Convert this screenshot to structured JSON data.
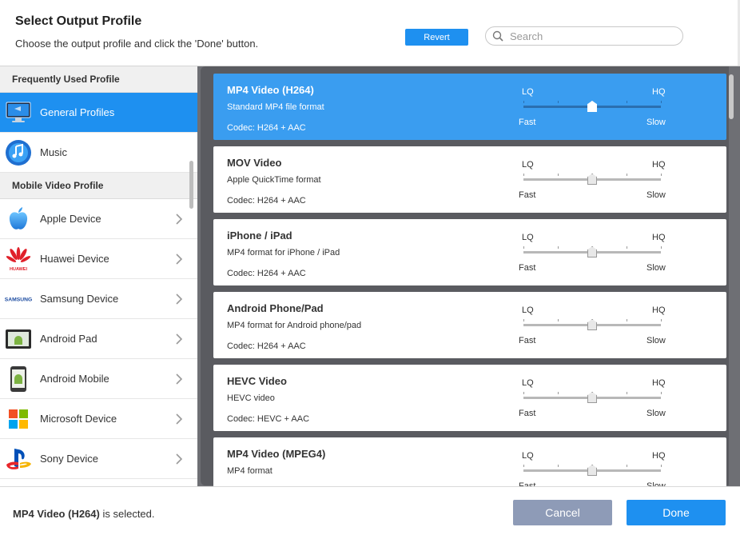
{
  "header": {
    "title": "Select Output Profile",
    "subtitle": "Choose the output profile and click the 'Done' button.",
    "revert_label": "Revert",
    "search_placeholder": "Search"
  },
  "sidebar": {
    "sections": [
      {
        "label": "Frequently Used Profile",
        "items": [
          {
            "label": "General Profiles",
            "icon": "monitor-icon",
            "active": true
          },
          {
            "label": "Music",
            "icon": "music-icon",
            "active": false
          }
        ]
      },
      {
        "label": "Mobile Video Profile",
        "items": [
          {
            "label": "Apple Device",
            "icon": "apple-icon"
          },
          {
            "label": "Huawei Device",
            "icon": "huawei-icon",
            "icon_text": "HUAWEI"
          },
          {
            "label": "Samsung Device",
            "icon": "samsung-icon",
            "icon_text": "SAMSUNG"
          },
          {
            "label": "Android Pad",
            "icon": "android-pad-icon"
          },
          {
            "label": "Android Mobile",
            "icon": "android-mobile-icon"
          },
          {
            "label": "Microsoft Device",
            "icon": "microsoft-icon"
          },
          {
            "label": "Sony Device",
            "icon": "playstation-icon"
          }
        ]
      }
    ]
  },
  "profiles": [
    {
      "title": "MP4 Video (H264)",
      "desc": "Standard MP4 file format",
      "codec": "Codec: H264 + AAC",
      "selected": true,
      "quality": 0.5
    },
    {
      "title": "MOV Video",
      "desc": "Apple QuickTime format",
      "codec": "Codec: H264 + AAC",
      "selected": false,
      "quality": 0.5
    },
    {
      "title": "iPhone / iPad",
      "desc": "MP4 format for iPhone / iPad",
      "codec": "Codec: H264 + AAC",
      "selected": false,
      "quality": 0.5
    },
    {
      "title": "Android Phone/Pad",
      "desc": "MP4 format for Android phone/pad",
      "codec": "Codec: H264 + AAC",
      "selected": false,
      "quality": 0.5
    },
    {
      "title": "HEVC Video",
      "desc": "HEVC video",
      "codec": "Codec: HEVC + AAC",
      "selected": false,
      "quality": 0.5
    },
    {
      "title": "MP4 Video (MPEG4)",
      "desc": "MP4 format",
      "codec": "",
      "selected": false,
      "quality": 0.5
    }
  ],
  "slider_labels": {
    "lq": "LQ",
    "hq": "HQ",
    "fast": "Fast",
    "slow": "Slow"
  },
  "footer": {
    "selected_name": "MP4 Video (H264)",
    "selected_suffix": " is selected.",
    "cancel_label": "Cancel",
    "done_label": "Done"
  },
  "colors": {
    "accent": "#1e90f0",
    "selected_card": "#3a9df0",
    "cancel": "#8e9bb7"
  }
}
